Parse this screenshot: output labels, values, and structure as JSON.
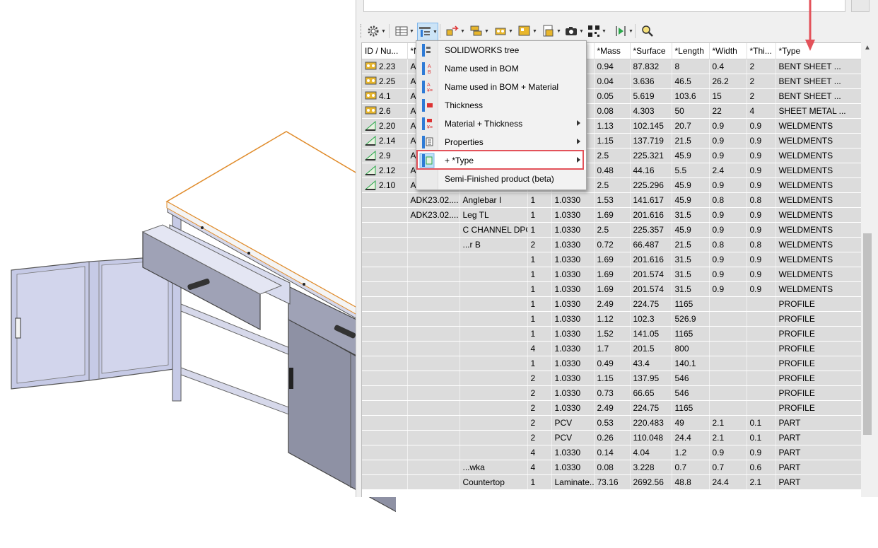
{
  "colors": {
    "accent_red": "#e3525a",
    "grid_row": "#dcdcdc",
    "cabinet_face": "#c6cae6",
    "cabinet_dark": "#8e91a4",
    "countertop_edge": "#e08b2a"
  },
  "toolbar": {
    "icons": [
      "settings-icon",
      "table-view-icon",
      "tree-structure-icon",
      "export-icon",
      "assembly-icon",
      "part-icon",
      "sheet-metal-icon",
      "document-icon",
      "camera-icon",
      "qr-code-icon",
      "play-icon",
      "zoom-icon"
    ]
  },
  "columns": [
    "ID / Nu...",
    "*N...",
    "",
    "",
    "",
    "*Mass",
    "*Surface",
    "*Length",
    "*Width",
    "*Thi...",
    "*Type"
  ],
  "rows": [
    {
      "icon": "sheet-metal",
      "id": "2.23",
      "name": "AD",
      "desc": "",
      "qty": "",
      "material": "",
      "mass": "0.94",
      "surface": "87.832",
      "length": "8",
      "width": "0.4",
      "thickness": "2",
      "type": "BENT SHEET ..."
    },
    {
      "icon": "sheet-metal",
      "id": "2.25",
      "name": "AD",
      "desc": "",
      "qty": "",
      "material": "",
      "mass": "0.04",
      "surface": "3.636",
      "length": "46.5",
      "width": "26.2",
      "thickness": "2",
      "type": "BENT SHEET ..."
    },
    {
      "icon": "sheet-metal",
      "id": "4.1",
      "name": "AD",
      "desc": "",
      "qty": "",
      "material": "",
      "mass": "0.05",
      "surface": "5.619",
      "length": "103.6",
      "width": "15",
      "thickness": "2",
      "type": "BENT SHEET ..."
    },
    {
      "icon": "sheet-metal",
      "id": "2.6",
      "name": "AD",
      "desc": "",
      "qty": "",
      "material": "",
      "mass": "0.08",
      "surface": "4.303",
      "length": "50",
      "width": "22",
      "thickness": "4",
      "type": "SHEET METAL ..."
    },
    {
      "icon": "weldment",
      "id": "2.20",
      "name": "AD",
      "desc": "",
      "qty": "",
      "material": "",
      "mass": "1.13",
      "surface": "102.145",
      "length": "20.7",
      "width": "0.9",
      "thickness": "0.9",
      "type": "WELDMENTS"
    },
    {
      "icon": "weldment",
      "id": "2.14",
      "name": "AD",
      "desc": "",
      "qty": "",
      "material": "",
      "mass": "1.15",
      "surface": "137.719",
      "length": "21.5",
      "width": "0.9",
      "thickness": "0.9",
      "type": "WELDMENTS"
    },
    {
      "icon": "weldment",
      "id": "2.9",
      "name": "AD",
      "desc": "",
      "qty": "",
      "material": "",
      "mass": "2.5",
      "surface": "225.321",
      "length": "45.9",
      "width": "0.9",
      "thickness": "0.9",
      "type": "WELDMENTS"
    },
    {
      "icon": "weldment",
      "id": "2.12",
      "name": "AD",
      "desc": "",
      "qty": "",
      "material": "",
      "mass": "0.48",
      "surface": "44.16",
      "length": "5.5",
      "width": "2.4",
      "thickness": "0.9",
      "type": "WELDMENTS"
    },
    {
      "icon": "weldment",
      "id": "2.10",
      "name": "AD",
      "desc": "",
      "qty": "",
      "material": "",
      "mass": "2.5",
      "surface": "225.296",
      "length": "45.9",
      "width": "0.9",
      "thickness": "0.9",
      "type": "WELDMENTS"
    },
    {
      "icon": "none",
      "id": "",
      "name": "ADK23.02....",
      "desc": "Anglebar I",
      "qty": "1",
      "material": "1.0330",
      "mass": "1.53",
      "surface": "141.617",
      "length": "45.9",
      "width": "0.8",
      "thickness": "0.8",
      "type": "WELDMENTS"
    },
    {
      "icon": "none",
      "id": "",
      "name": "ADK23.02....",
      "desc": "Leg TL",
      "qty": "1",
      "material": "1.0330",
      "mass": "1.69",
      "surface": "201.616",
      "length": "31.5",
      "width": "0.9",
      "thickness": "0.9",
      "type": "WELDMENTS"
    },
    {
      "icon": "none",
      "id": "",
      "name": "",
      "desc": "C CHANNEL DPG",
      "qty": "1",
      "material": "1.0330",
      "mass": "2.5",
      "surface": "225.357",
      "length": "45.9",
      "width": "0.9",
      "thickness": "0.9",
      "type": "WELDMENTS"
    },
    {
      "icon": "none",
      "id": "",
      "name": "",
      "desc": "...r B",
      "qty": "2",
      "material": "1.0330",
      "mass": "0.72",
      "surface": "66.487",
      "length": "21.5",
      "width": "0.8",
      "thickness": "0.8",
      "type": "WELDMENTS"
    },
    {
      "icon": "none",
      "id": "",
      "name": "",
      "desc": "",
      "qty": "1",
      "material": "1.0330",
      "mass": "1.69",
      "surface": "201.616",
      "length": "31.5",
      "width": "0.9",
      "thickness": "0.9",
      "type": "WELDMENTS"
    },
    {
      "icon": "none",
      "id": "",
      "name": "",
      "desc": "",
      "qty": "1",
      "material": "1.0330",
      "mass": "1.69",
      "surface": "201.574",
      "length": "31.5",
      "width": "0.9",
      "thickness": "0.9",
      "type": "WELDMENTS"
    },
    {
      "icon": "none",
      "id": "",
      "name": "",
      "desc": "",
      "qty": "1",
      "material": "1.0330",
      "mass": "1.69",
      "surface": "201.574",
      "length": "31.5",
      "width": "0.9",
      "thickness": "0.9",
      "type": "WELDMENTS"
    },
    {
      "icon": "none",
      "id": "",
      "name": "",
      "desc": "",
      "qty": "1",
      "material": "1.0330",
      "mass": "2.49",
      "surface": "224.75",
      "length": "1165",
      "width": "",
      "thickness": "",
      "type": "PROFILE"
    },
    {
      "icon": "none",
      "id": "",
      "name": "",
      "desc": "",
      "qty": "1",
      "material": "1.0330",
      "mass": "1.12",
      "surface": "102.3",
      "length": "526.9",
      "width": "",
      "thickness": "",
      "type": "PROFILE"
    },
    {
      "icon": "none",
      "id": "",
      "name": "",
      "desc": "",
      "qty": "1",
      "material": "1.0330",
      "mass": "1.52",
      "surface": "141.05",
      "length": "1165",
      "width": "",
      "thickness": "",
      "type": "PROFILE"
    },
    {
      "icon": "none",
      "id": "",
      "name": "",
      "desc": "",
      "qty": "4",
      "material": "1.0330",
      "mass": "1.7",
      "surface": "201.5",
      "length": "800",
      "width": "",
      "thickness": "",
      "type": "PROFILE"
    },
    {
      "icon": "none",
      "id": "",
      "name": "",
      "desc": "",
      "qty": "1",
      "material": "1.0330",
      "mass": "0.49",
      "surface": "43.4",
      "length": "140.1",
      "width": "",
      "thickness": "",
      "type": "PROFILE"
    },
    {
      "icon": "none",
      "id": "",
      "name": "",
      "desc": "",
      "qty": "2",
      "material": "1.0330",
      "mass": "1.15",
      "surface": "137.95",
      "length": "546",
      "width": "",
      "thickness": "",
      "type": "PROFILE"
    },
    {
      "icon": "none",
      "id": "",
      "name": "",
      "desc": "",
      "qty": "2",
      "material": "1.0330",
      "mass": "0.73",
      "surface": "66.65",
      "length": "546",
      "width": "",
      "thickness": "",
      "type": "PROFILE"
    },
    {
      "icon": "none",
      "id": "",
      "name": "",
      "desc": "",
      "qty": "2",
      "material": "1.0330",
      "mass": "2.49",
      "surface": "224.75",
      "length": "1165",
      "width": "",
      "thickness": "",
      "type": "PROFILE"
    },
    {
      "icon": "none",
      "id": "",
      "name": "",
      "desc": "",
      "qty": "2",
      "material": "PCV",
      "mass": "0.53",
      "surface": "220.483",
      "length": "49",
      "width": "2.1",
      "thickness": "0.1",
      "type": "PART"
    },
    {
      "icon": "none",
      "id": "",
      "name": "",
      "desc": "",
      "qty": "2",
      "material": "PCV",
      "mass": "0.26",
      "surface": "110.048",
      "length": "24.4",
      "width": "2.1",
      "thickness": "0.1",
      "type": "PART"
    },
    {
      "icon": "none",
      "id": "",
      "name": "",
      "desc": "",
      "qty": "4",
      "material": "1.0330",
      "mass": "0.14",
      "surface": "4.04",
      "length": "1.2",
      "width": "0.9",
      "thickness": "0.9",
      "type": "PART"
    },
    {
      "icon": "none",
      "id": "",
      "name": "",
      "desc": "...wka",
      "qty": "4",
      "material": "1.0330",
      "mass": "0.08",
      "surface": "3.228",
      "length": "0.7",
      "width": "0.7",
      "thickness": "0.6",
      "type": "PART"
    },
    {
      "icon": "none",
      "id": "",
      "name": "",
      "desc": "Countertop",
      "qty": "1",
      "material": "Laminate...",
      "mass": "73.16",
      "surface": "2692.56",
      "length": "48.8",
      "width": "24.4",
      "thickness": "2.1",
      "type": "PART"
    }
  ],
  "context_menu": {
    "items": [
      {
        "label": "SOLIDWORKS tree",
        "icon": "solidworks-tree-icon",
        "submenu": false
      },
      {
        "label": "Name used in BOM",
        "icon": "name-bom-icon",
        "submenu": false
      },
      {
        "label": "Name used in BOM + Material",
        "icon": "name-bom-material-icon",
        "submenu": false
      },
      {
        "label": "Thickness",
        "icon": "thickness-icon",
        "submenu": false
      },
      {
        "label": "Material + Thickness",
        "icon": "material-thickness-icon",
        "submenu": true
      },
      {
        "label": "Properties",
        "icon": "properties-icon",
        "submenu": true
      },
      {
        "label": "+ *Type",
        "icon": "type-icon",
        "submenu": true
      },
      {
        "label": "Semi-Finished product (beta)",
        "icon": "",
        "submenu": false
      }
    ],
    "highlighted_item": "+ *Type"
  }
}
